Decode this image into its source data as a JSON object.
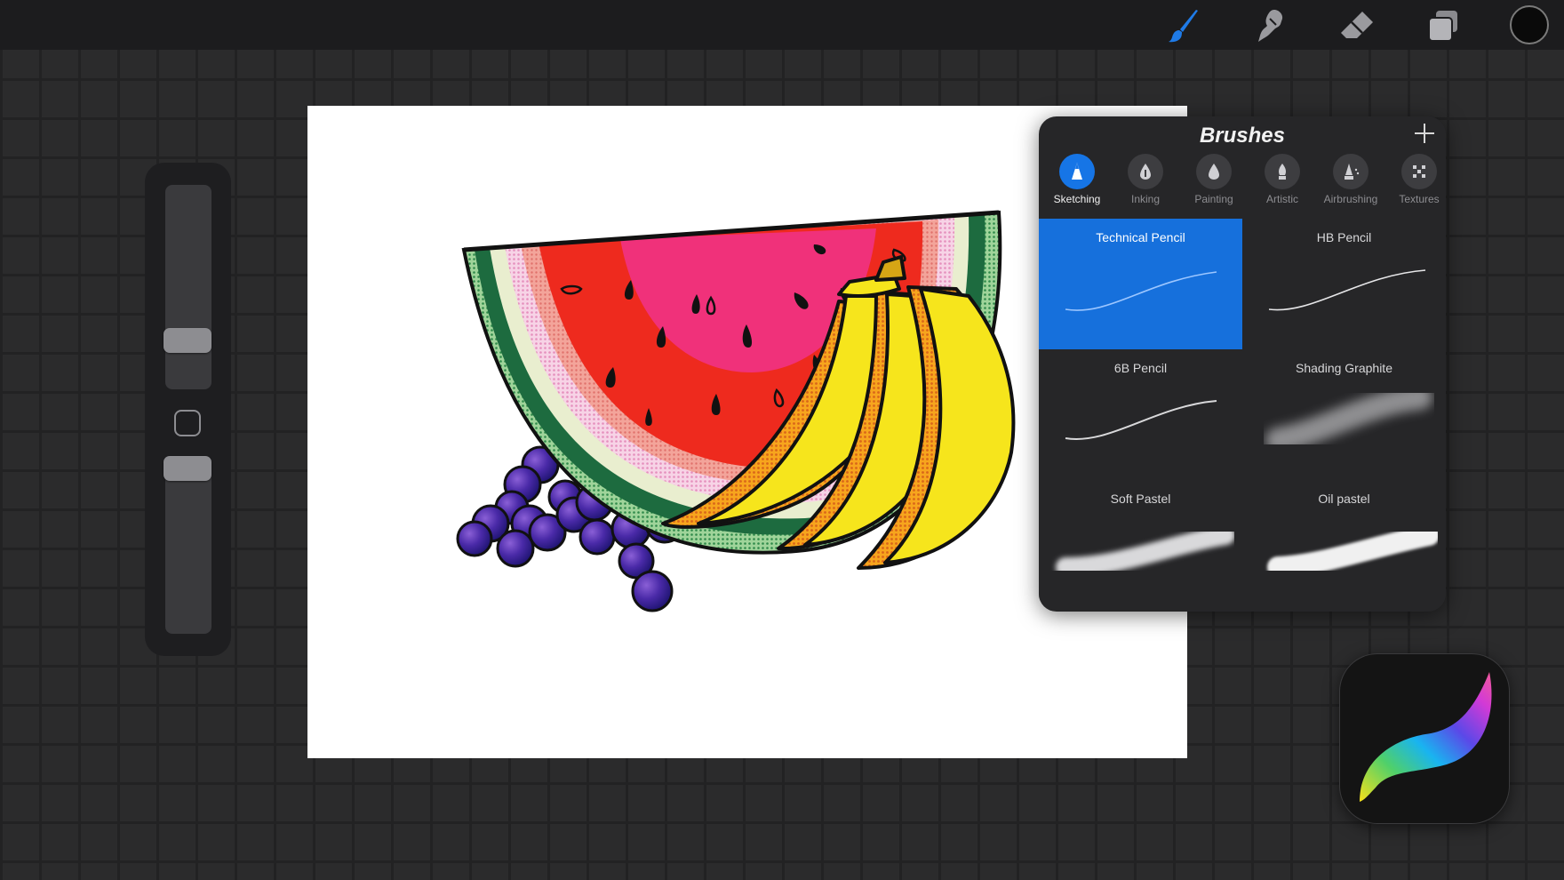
{
  "toolbar": {
    "tools": [
      {
        "name": "brush",
        "icon": "brush-icon",
        "active": true,
        "color": "#1f7be8"
      },
      {
        "name": "smudge",
        "icon": "smudge-icon",
        "active": false
      },
      {
        "name": "eraser",
        "icon": "eraser-icon",
        "active": false
      },
      {
        "name": "layers",
        "icon": "layers-icon",
        "active": false
      }
    ],
    "current_color": "#0a0a0a"
  },
  "sidebar": {
    "brush_size_level": 0.73,
    "opacity_level": 0.22
  },
  "brush_library": {
    "title": "Brushes",
    "add_icon": "plus-icon",
    "categories": [
      {
        "label": "Sketching",
        "icon": "pencil-nib-icon",
        "active": true
      },
      {
        "label": "Inking",
        "icon": "ink-drop-icon",
        "active": false
      },
      {
        "label": "Painting",
        "icon": "paint-drop-icon",
        "active": false
      },
      {
        "label": "Artistic",
        "icon": "artistic-nib-icon",
        "active": false
      },
      {
        "label": "Airbrushing",
        "icon": "airbrush-icon",
        "active": false
      },
      {
        "label": "Textures",
        "icon": "texture-icon",
        "active": false
      }
    ],
    "brushes": [
      {
        "name": "Technical Pencil",
        "selected": true
      },
      {
        "name": "HB Pencil",
        "selected": false
      },
      {
        "name": "6B Pencil",
        "selected": false
      },
      {
        "name": "Shading Graphite",
        "selected": false
      },
      {
        "name": "Soft Pastel",
        "selected": false
      },
      {
        "name": "Oil pastel",
        "selected": false
      }
    ],
    "accent_color": "#1670dc"
  },
  "app_icon": {
    "icon": "procreate-logo-icon"
  }
}
